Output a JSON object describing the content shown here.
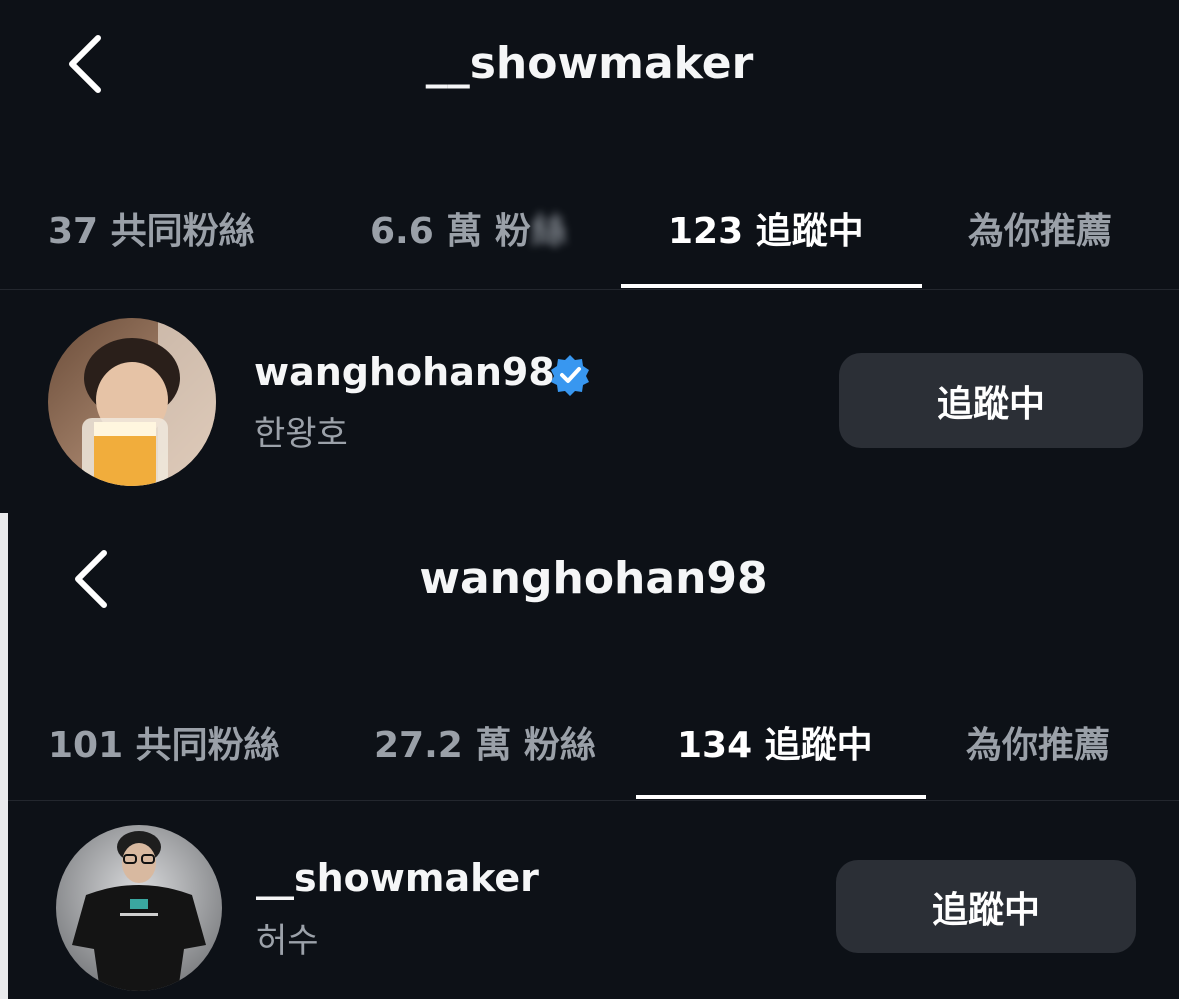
{
  "screens": [
    {
      "header": {
        "title": "__showmaker",
        "back_icon": "chevron-left-icon"
      },
      "tabs": [
        {
          "label": "37 共同粉絲",
          "active": false
        },
        {
          "label_prefix": "6.6 萬 粉",
          "label_blurred": "絲",
          "active": false
        },
        {
          "label": "123 追蹤中",
          "active": true
        },
        {
          "label": "為你推薦",
          "active": false
        }
      ],
      "user": {
        "username": "wanghohan98",
        "display_name": "한왕호",
        "verified": true,
        "verified_icon": "verified-badge-icon",
        "avatar_icon": "avatar-photo",
        "button_label": "追蹤中"
      }
    },
    {
      "header": {
        "title": "wanghohan98",
        "back_icon": "chevron-left-icon"
      },
      "tabs": [
        {
          "label": "101 共同粉絲",
          "active": false
        },
        {
          "label": "27.2 萬 粉絲",
          "active": false
        },
        {
          "label": "134 追蹤中",
          "active": true
        },
        {
          "label": "為你推薦",
          "active": false
        }
      ],
      "user": {
        "username": "__showmaker",
        "display_name": "허수",
        "verified": false,
        "avatar_icon": "avatar-photo",
        "button_label": "追蹤中"
      }
    }
  ],
  "colors": {
    "background": "#0d1117",
    "active_tab": "#ffffff",
    "inactive_tab": "#9aa0a8",
    "button_bg": "#2b2f36",
    "verified_blue": "#3897f0"
  }
}
